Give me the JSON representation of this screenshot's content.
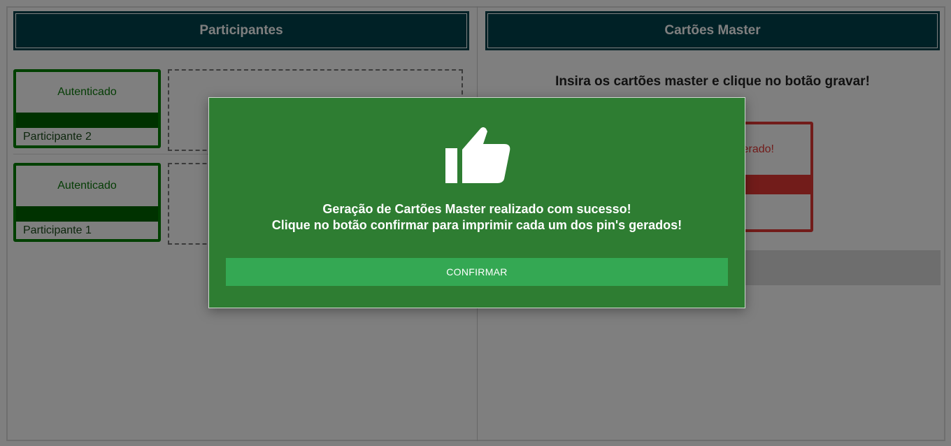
{
  "left_panel": {
    "title": "Participantes",
    "participants": [
      {
        "status": "Autenticado",
        "name": "Participante 2"
      },
      {
        "status": "Autenticado",
        "name": "Participante 1"
      }
    ]
  },
  "right_panel": {
    "title": "Cartões Master",
    "instruction": "Insira os cartões master e clique no botão gravar!",
    "master_card_status_partial": "erado!"
  },
  "modal": {
    "icon": "thumbs-up-icon",
    "line1": "Geração de Cartões Master realizado com sucesso!",
    "line2": "Clique no botão confirmar para imprimir cada um dos pin's gerados!",
    "confirm_label": "CONFIRMAR"
  },
  "colors": {
    "header_bg": "#00424d",
    "success_green": "#2e7d32",
    "button_green": "#34a853",
    "card_border_green": "#008000",
    "error_red": "#e53935"
  }
}
